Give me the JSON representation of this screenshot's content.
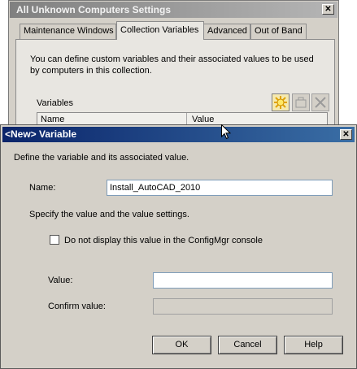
{
  "back_window": {
    "title": "All Unknown Computers Settings",
    "close_glyph": "✕",
    "tabs": [
      {
        "label": "Maintenance Windows",
        "active": false
      },
      {
        "label": "Collection Variables",
        "active": true
      },
      {
        "label": "Advanced",
        "active": false
      },
      {
        "label": "Out of Band",
        "active": false
      }
    ],
    "description": "You can define custom variables and their associated values to be used by computers in this collection.",
    "variables_label": "Variables",
    "toolbar_icons": [
      "new-variable-icon",
      "properties-icon",
      "delete-icon"
    ],
    "columns": {
      "name": "Name",
      "value": "Value"
    }
  },
  "dialog": {
    "title": "<New> Variable",
    "close_glyph": "✕",
    "description": "Define the variable and its associated value.",
    "name_label": "Name:",
    "name_value": "Install_AutoCAD_2010",
    "specify_text": "Specify the value and the value settings.",
    "checkbox_label": "Do not display this value in the ConfigMgr console",
    "checkbox_checked": false,
    "value_label": "Value:",
    "value_value": "",
    "confirm_label": "Confirm value:",
    "confirm_value": "",
    "buttons": {
      "ok": "OK",
      "cancel": "Cancel",
      "help": "Help"
    }
  },
  "colors": {
    "dialog_titlebar": "#0a246a",
    "inactive_titlebar": "#808080",
    "window_face": "#d4d0c8"
  }
}
